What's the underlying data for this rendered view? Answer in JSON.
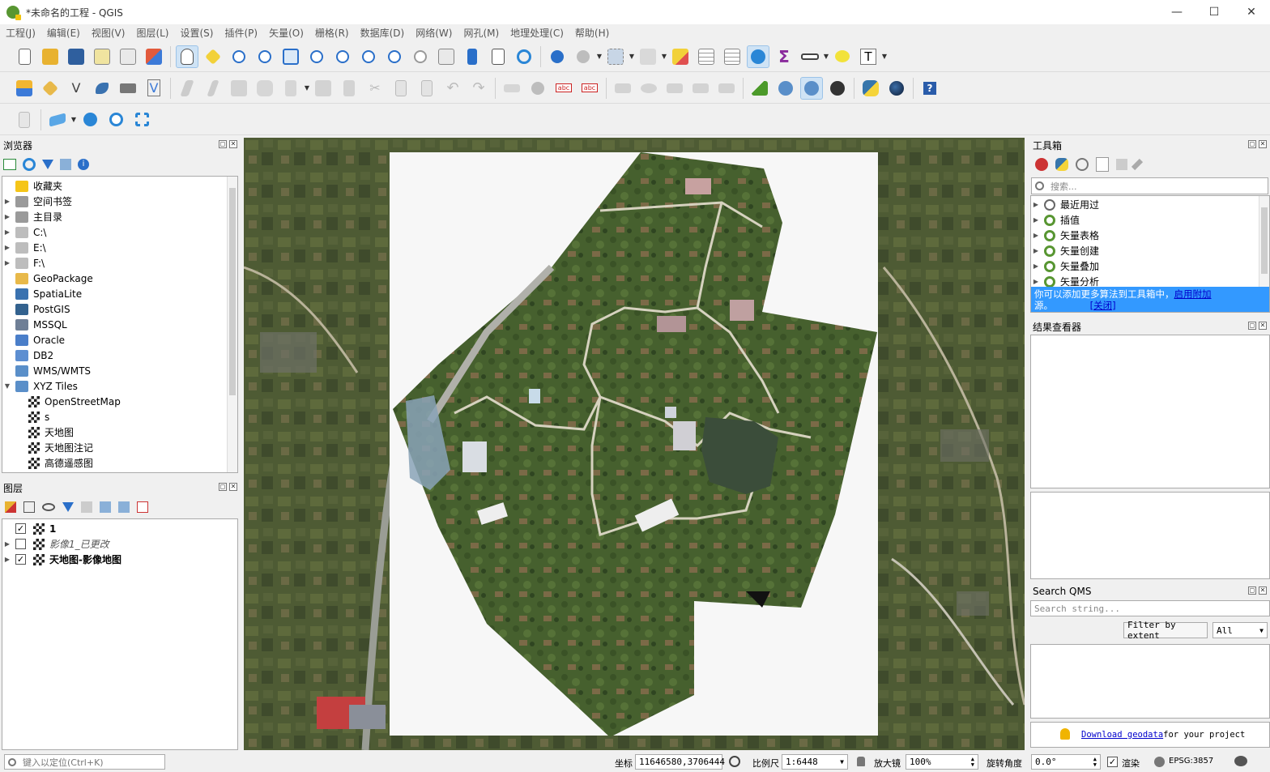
{
  "window": {
    "title": "*未命名的工程 - QGIS",
    "minimize": "—",
    "maximize": "☐",
    "close": "✕"
  },
  "menu": [
    "工程(J)",
    "编辑(E)",
    "视图(V)",
    "图层(L)",
    "设置(S)",
    "插件(P)",
    "矢量(O)",
    "栅格(R)",
    "数据库(D)",
    "网络(W)",
    "网孔(M)",
    "地理处理(C)",
    "帮助(H)"
  ],
  "browser": {
    "title": "浏览器",
    "items": [
      {
        "label": "收藏夹",
        "icon": "star-icon",
        "color": "#f5c518",
        "arrow": ""
      },
      {
        "label": "空间书签",
        "icon": "bookmark-icon",
        "color": "#9a9a9a",
        "arrow": "▶"
      },
      {
        "label": "主目录",
        "icon": "home-folder-icon",
        "color": "#9a9a9a",
        "arrow": "▶"
      },
      {
        "label": "C:\\",
        "icon": "drive-icon",
        "color": "#bdbdbd",
        "arrow": "▶"
      },
      {
        "label": "E:\\",
        "icon": "drive-icon",
        "color": "#bdbdbd",
        "arrow": "▶"
      },
      {
        "label": "F:\\",
        "icon": "drive-icon",
        "color": "#bdbdbd",
        "arrow": "▶"
      },
      {
        "label": "GeoPackage",
        "icon": "geopackage-icon",
        "color": "#e8b94a",
        "arrow": ""
      },
      {
        "label": "SpatiaLite",
        "icon": "spatialite-icon",
        "color": "#3a72b0",
        "arrow": ""
      },
      {
        "label": "PostGIS",
        "icon": "postgis-icon",
        "color": "#33628f",
        "arrow": ""
      },
      {
        "label": "MSSQL",
        "icon": "mssql-icon",
        "color": "#6f7f96",
        "arrow": ""
      },
      {
        "label": "Oracle",
        "icon": "oracle-icon",
        "color": "#4a7ec9",
        "arrow": ""
      },
      {
        "label": "DB2",
        "icon": "db2-icon",
        "color": "#5c8ed1",
        "arrow": ""
      },
      {
        "label": "WMS/WMTS",
        "icon": "globe-icon",
        "color": "#5a8fc9",
        "arrow": ""
      },
      {
        "label": "XYZ Tiles",
        "icon": "globe-icon",
        "color": "#5a8fc9",
        "arrow": "▼"
      }
    ],
    "xyz_children": [
      "OpenStreetMap",
      "s",
      "天地图",
      "天地图注记",
      "高德遥感图"
    ]
  },
  "layers": {
    "title": "图层",
    "items": [
      {
        "label": "1",
        "checked": "✓",
        "arrow": "",
        "style": "bold"
      },
      {
        "label": "影像1_已更改",
        "checked": "",
        "arrow": "▶",
        "style": "italic"
      },
      {
        "label": "天地图-影像地图",
        "checked": "✓",
        "arrow": "▶",
        "style": "bold"
      }
    ]
  },
  "toolbox": {
    "title": "工具箱",
    "search_placeholder": "搜索...",
    "items": [
      "最近用过",
      "插值",
      "矢量表格",
      "矢量创建",
      "矢量叠加",
      "矢量分析"
    ],
    "notice": "你可以添加更多算法到工具箱中，",
    "notice_link": "启用附加",
    "notice_tail": "源。",
    "notice_close": "[关闭]"
  },
  "results": {
    "title": "结果查看器"
  },
  "qms": {
    "title": "Search QMS",
    "search_placeholder": "Search string...",
    "filter_button": "Filter by extent",
    "filter_value": "All",
    "download_link": "Download geodata",
    "download_tail": " for your project"
  },
  "status": {
    "locate_placeholder": "键入以定位(Ctrl+K)",
    "coord_label": "坐标",
    "coord_value": "11646580,3706444",
    "scale_label": "比例尺",
    "scale_value": "1:6448",
    "magnifier_label": "放大镜",
    "magnifier_value": "100%",
    "rotation_label": "旋转角度",
    "rotation_value": "0.0°",
    "render_label": "渲染",
    "render_checked": "✓",
    "crs": "EPSG:3857"
  },
  "colors": {
    "accent": "#3399ff",
    "notice_bg": "#3399ff",
    "link": "#0000cc"
  }
}
